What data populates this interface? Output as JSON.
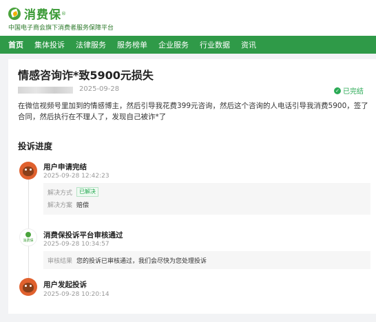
{
  "brand": {
    "name": "消费保",
    "registered": "®",
    "tagline": "中国电子商会旗下消费者服务保障平台",
    "node_label": "消费保"
  },
  "nav": {
    "items": [
      "首页",
      "集体投诉",
      "法律服务",
      "服务榜单",
      "企业服务",
      "行业数据",
      "资讯"
    ],
    "active_index": 0
  },
  "complaint": {
    "title": "情感咨询诈*致5900元损失",
    "date": "2025-09-28",
    "status": "已完结",
    "description": "在微信视频号里加到的情感博主，然后引导我花费399元咨询，然后这个咨询的人电话引导我消费5900，签了合同，然后执行在不理人了，发现自己被诈*了"
  },
  "progress": {
    "heading": "投诉进度",
    "steps": [
      {
        "title": "用户申请完结",
        "time": "2025-09-28 12:42:23",
        "details": [
          {
            "label": "解决方式",
            "value": "已解决",
            "type": "tag"
          },
          {
            "label": "解决方案",
            "value": "赔偿",
            "type": "text"
          }
        ]
      },
      {
        "title": "消费保投诉平台审核通过",
        "time": "2025-09-28 10:34:57",
        "details": [
          {
            "label": "审核结果",
            "value": "您的投诉已审核通过，我们会尽快为您处理投诉",
            "type": "text"
          }
        ]
      },
      {
        "title": "用户发起投诉",
        "time": "2025-09-28 10:20:14",
        "details": []
      }
    ]
  },
  "colors": {
    "brand_green": "#3a9a35",
    "nav_green": "#2f9a48",
    "status_green": "#2aaa55",
    "owl_orange": "#e0612e"
  }
}
